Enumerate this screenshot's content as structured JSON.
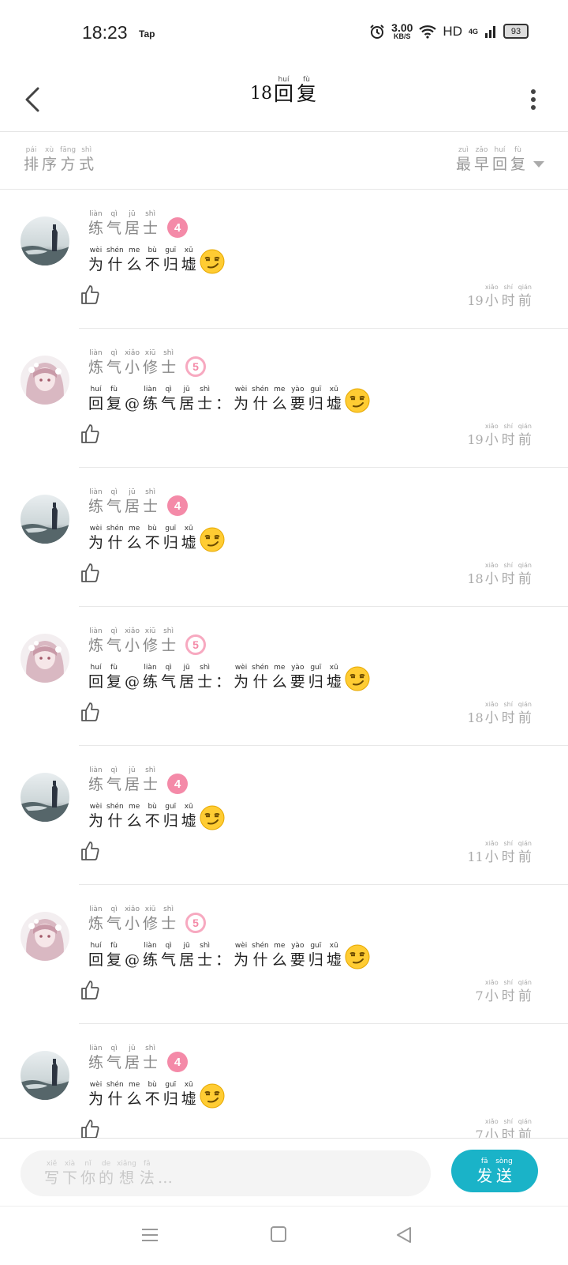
{
  "status": {
    "time": "18:23",
    "app": "Tap",
    "speed_value": "3.00",
    "speed_unit": "KB/S",
    "hd": "HD",
    "network": "4G",
    "battery": "93"
  },
  "header": {
    "count": "18",
    "title": [
      {
        "hz": "回",
        "py": "huí"
      },
      {
        "hz": "复",
        "py": "fù"
      }
    ]
  },
  "sort": {
    "label": [
      {
        "hz": "排",
        "py": "pái"
      },
      {
        "hz": "序",
        "py": "xù"
      },
      {
        "hz": "方",
        "py": "fāng"
      },
      {
        "hz": "式",
        "py": "shì"
      }
    ],
    "selected": [
      {
        "hz": "最",
        "py": "zuì"
      },
      {
        "hz": "早",
        "py": "zǎo"
      },
      {
        "hz": "回",
        "py": "huí"
      },
      {
        "hz": "复",
        "py": "fù"
      }
    ]
  },
  "comments": [
    {
      "avatar": "landscape",
      "level": "4",
      "name": [
        {
          "hz": "练",
          "py": "liàn"
        },
        {
          "hz": "气",
          "py": "qì"
        },
        {
          "hz": "居",
          "py": "jū"
        },
        {
          "hz": "士",
          "py": "shì"
        }
      ],
      "content": [
        {
          "hz": "为",
          "py": "wèi"
        },
        {
          "hz": "什",
          "py": "shén"
        },
        {
          "hz": "么",
          "py": "me"
        },
        {
          "hz": "不",
          "py": "bù"
        },
        {
          "hz": "归",
          "py": "guī"
        },
        {
          "hz": "墟",
          "py": "xū"
        }
      ],
      "time_num": "19",
      "time": [
        {
          "hz": "小",
          "py": "xiǎo"
        },
        {
          "hz": "时",
          "py": "shí"
        },
        {
          "hz": "前",
          "py": "qián"
        }
      ]
    },
    {
      "avatar": "girl",
      "level": "5",
      "name": [
        {
          "hz": "炼",
          "py": "liàn"
        },
        {
          "hz": "气",
          "py": "qì"
        },
        {
          "hz": "小",
          "py": "xiǎo"
        },
        {
          "hz": "修",
          "py": "xiū"
        },
        {
          "hz": "士",
          "py": "shì"
        }
      ],
      "content": [
        {
          "hz": "回",
          "py": "huí"
        },
        {
          "hz": "复",
          "py": "fù"
        },
        {
          "hz": "@",
          "py": ""
        },
        {
          "hz": "练",
          "py": "liàn"
        },
        {
          "hz": "气",
          "py": "qì"
        },
        {
          "hz": "居",
          "py": "jū"
        },
        {
          "hz": "士",
          "py": "shì"
        },
        {
          "hz": "：",
          "py": ""
        },
        {
          "hz": "为",
          "py": "wèi"
        },
        {
          "hz": "什",
          "py": "shén"
        },
        {
          "hz": "么",
          "py": "me"
        },
        {
          "hz": "要",
          "py": "yào"
        },
        {
          "hz": "归",
          "py": "guī"
        },
        {
          "hz": "墟",
          "py": "xū"
        }
      ],
      "time_num": "19",
      "time": [
        {
          "hz": "小",
          "py": "xiǎo"
        },
        {
          "hz": "时",
          "py": "shí"
        },
        {
          "hz": "前",
          "py": "qián"
        }
      ]
    },
    {
      "avatar": "landscape",
      "level": "4",
      "name": [
        {
          "hz": "练",
          "py": "liàn"
        },
        {
          "hz": "气",
          "py": "qì"
        },
        {
          "hz": "居",
          "py": "jū"
        },
        {
          "hz": "士",
          "py": "shì"
        }
      ],
      "content": [
        {
          "hz": "为",
          "py": "wèi"
        },
        {
          "hz": "什",
          "py": "shén"
        },
        {
          "hz": "么",
          "py": "me"
        },
        {
          "hz": "不",
          "py": "bù"
        },
        {
          "hz": "归",
          "py": "guī"
        },
        {
          "hz": "墟",
          "py": "xū"
        }
      ],
      "time_num": "18",
      "time": [
        {
          "hz": "小",
          "py": "xiǎo"
        },
        {
          "hz": "时",
          "py": "shí"
        },
        {
          "hz": "前",
          "py": "qián"
        }
      ]
    },
    {
      "avatar": "girl",
      "level": "5",
      "name": [
        {
          "hz": "炼",
          "py": "liàn"
        },
        {
          "hz": "气",
          "py": "qì"
        },
        {
          "hz": "小",
          "py": "xiǎo"
        },
        {
          "hz": "修",
          "py": "xiū"
        },
        {
          "hz": "士",
          "py": "shì"
        }
      ],
      "content": [
        {
          "hz": "回",
          "py": "huí"
        },
        {
          "hz": "复",
          "py": "fù"
        },
        {
          "hz": "@",
          "py": ""
        },
        {
          "hz": "练",
          "py": "liàn"
        },
        {
          "hz": "气",
          "py": "qì"
        },
        {
          "hz": "居",
          "py": "jū"
        },
        {
          "hz": "士",
          "py": "shì"
        },
        {
          "hz": "：",
          "py": ""
        },
        {
          "hz": "为",
          "py": "wèi"
        },
        {
          "hz": "什",
          "py": "shén"
        },
        {
          "hz": "么",
          "py": "me"
        },
        {
          "hz": "要",
          "py": "yào"
        },
        {
          "hz": "归",
          "py": "guī"
        },
        {
          "hz": "墟",
          "py": "xū"
        }
      ],
      "time_num": "18",
      "time": [
        {
          "hz": "小",
          "py": "xiǎo"
        },
        {
          "hz": "时",
          "py": "shí"
        },
        {
          "hz": "前",
          "py": "qián"
        }
      ]
    },
    {
      "avatar": "landscape",
      "level": "4",
      "name": [
        {
          "hz": "练",
          "py": "liàn"
        },
        {
          "hz": "气",
          "py": "qì"
        },
        {
          "hz": "居",
          "py": "jū"
        },
        {
          "hz": "士",
          "py": "shì"
        }
      ],
      "content": [
        {
          "hz": "为",
          "py": "wèi"
        },
        {
          "hz": "什",
          "py": "shén"
        },
        {
          "hz": "么",
          "py": "me"
        },
        {
          "hz": "不",
          "py": "bù"
        },
        {
          "hz": "归",
          "py": "guī"
        },
        {
          "hz": "墟",
          "py": "xū"
        }
      ],
      "time_num": "11",
      "time": [
        {
          "hz": "小",
          "py": "xiǎo"
        },
        {
          "hz": "时",
          "py": "shí"
        },
        {
          "hz": "前",
          "py": "qián"
        }
      ]
    },
    {
      "avatar": "girl",
      "level": "5",
      "name": [
        {
          "hz": "炼",
          "py": "liàn"
        },
        {
          "hz": "气",
          "py": "qì"
        },
        {
          "hz": "小",
          "py": "xiǎo"
        },
        {
          "hz": "修",
          "py": "xiū"
        },
        {
          "hz": "士",
          "py": "shì"
        }
      ],
      "content": [
        {
          "hz": "回",
          "py": "huí"
        },
        {
          "hz": "复",
          "py": "fù"
        },
        {
          "hz": "@",
          "py": ""
        },
        {
          "hz": "练",
          "py": "liàn"
        },
        {
          "hz": "气",
          "py": "qì"
        },
        {
          "hz": "居",
          "py": "jū"
        },
        {
          "hz": "士",
          "py": "shì"
        },
        {
          "hz": "：",
          "py": ""
        },
        {
          "hz": "为",
          "py": "wèi"
        },
        {
          "hz": "什",
          "py": "shén"
        },
        {
          "hz": "么",
          "py": "me"
        },
        {
          "hz": "要",
          "py": "yào"
        },
        {
          "hz": "归",
          "py": "guī"
        },
        {
          "hz": "墟",
          "py": "xū"
        }
      ],
      "time_num": "7",
      "time": [
        {
          "hz": "小",
          "py": "xiǎo"
        },
        {
          "hz": "时",
          "py": "shí"
        },
        {
          "hz": "前",
          "py": "qián"
        }
      ]
    },
    {
      "avatar": "landscape",
      "level": "4",
      "name": [
        {
          "hz": "练",
          "py": "liàn"
        },
        {
          "hz": "气",
          "py": "qì"
        },
        {
          "hz": "居",
          "py": "jū"
        },
        {
          "hz": "士",
          "py": "shì"
        }
      ],
      "content": [
        {
          "hz": "为",
          "py": "wèi"
        },
        {
          "hz": "什",
          "py": "shén"
        },
        {
          "hz": "么",
          "py": "me"
        },
        {
          "hz": "不",
          "py": "bù"
        },
        {
          "hz": "归",
          "py": "guī"
        },
        {
          "hz": "墟",
          "py": "xū"
        }
      ],
      "time_num": "7",
      "time": [
        {
          "hz": "小",
          "py": "xiǎo"
        },
        {
          "hz": "时",
          "py": "shí"
        },
        {
          "hz": "前",
          "py": "qián"
        }
      ]
    }
  ],
  "composer": {
    "placeholder": [
      {
        "hz": "写",
        "py": "xiě"
      },
      {
        "hz": "下",
        "py": "xià"
      },
      {
        "hz": "你",
        "py": "nǐ"
      },
      {
        "hz": "的",
        "py": "de"
      },
      {
        "hz": "想",
        "py": "xiǎng"
      },
      {
        "hz": "法",
        "py": "fǎ"
      },
      {
        "hz": "…",
        "py": ""
      }
    ],
    "send": [
      {
        "hz": "发",
        "py": "fā"
      },
      {
        "hz": "送",
        "py": "sòng"
      }
    ]
  },
  "colors": {
    "accent": "#1ab3c8",
    "level_badge": "#f48aa8"
  },
  "icons": {
    "back": "back-arrow-icon",
    "more": "more-vertical-icon",
    "like": "thumbs-up-icon",
    "emoji": "smirk-emoji-icon"
  }
}
